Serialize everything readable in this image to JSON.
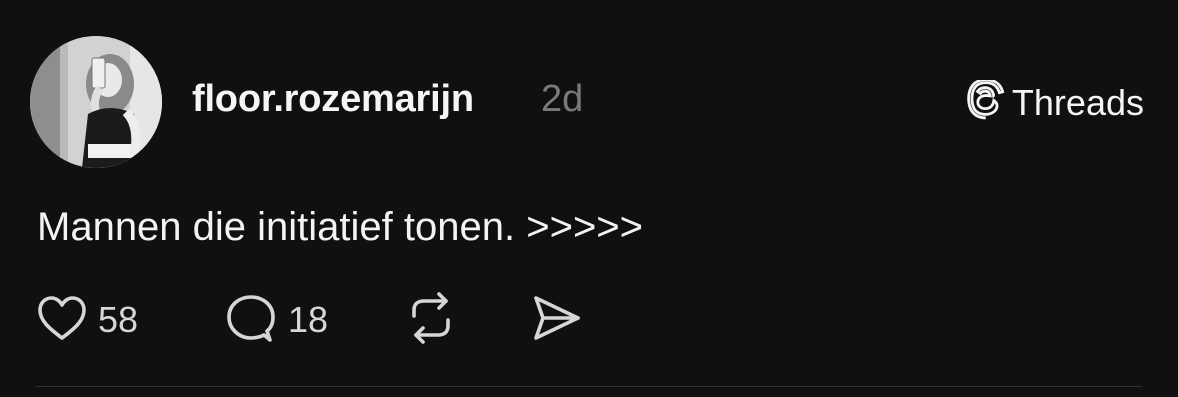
{
  "post": {
    "username": "floor.rozemarijn",
    "time": "2d",
    "brand": "Threads",
    "text": "Mannen die initiatief tonen. >>>>>",
    "likes": "58",
    "replies": "18"
  },
  "icons": {
    "brand": "threads-logo-icon",
    "like": "heart-icon",
    "reply": "speech-bubble-icon",
    "repost": "repost-icon",
    "share": "send-icon"
  },
  "colors": {
    "background": "#101010",
    "text": "#f3f3f3",
    "muted": "#7a7a7a",
    "icon": "#d6d6d6"
  }
}
